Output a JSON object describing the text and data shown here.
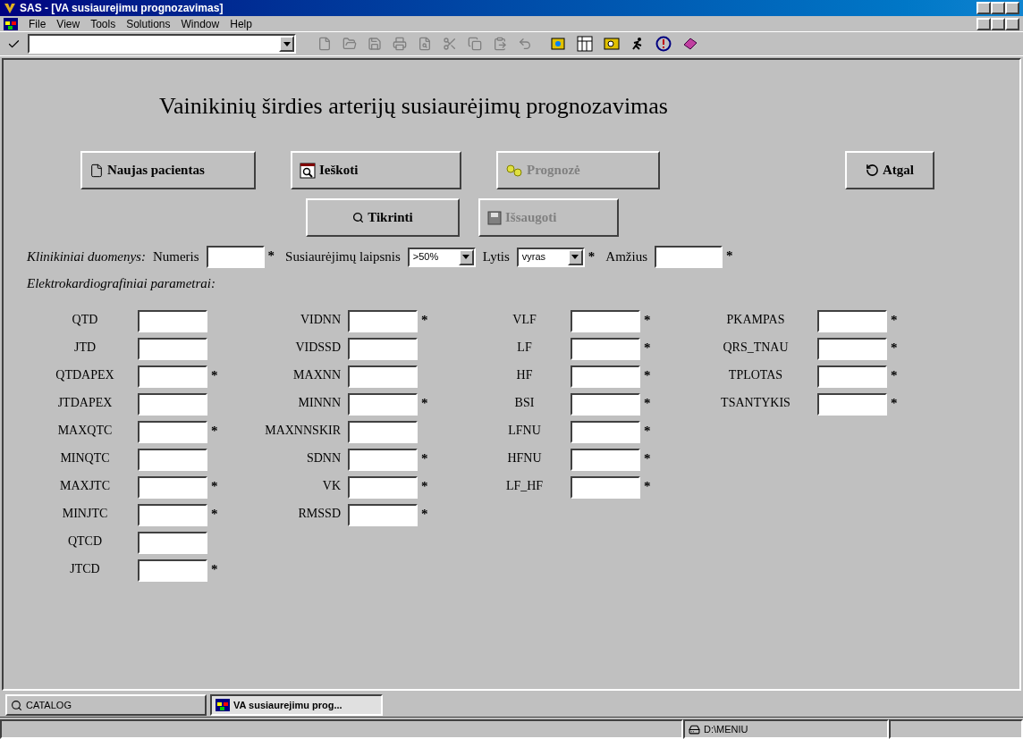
{
  "window": {
    "title": "SAS - [VA susiaurejimu prognozavimas]"
  },
  "menu": [
    "File",
    "View",
    "Tools",
    "Solutions",
    "Window",
    "Help"
  ],
  "form": {
    "heading": "Vainikinių širdies arterijų susiaurėjimų prognozavimas",
    "buttons_row1": [
      {
        "label": "Naujas pacientas",
        "kind": "new",
        "disabled": false
      },
      {
        "label": "Ieškoti",
        "kind": "find",
        "disabled": false
      },
      {
        "label": "Prognozė",
        "kind": "predict",
        "disabled": true
      },
      {
        "label": "Atgal",
        "kind": "back",
        "disabled": false
      }
    ],
    "buttons_row2": [
      {
        "label": "Tikrinti",
        "kind": "check",
        "disabled": false
      },
      {
        "label": "Išsaugoti",
        "kind": "save",
        "disabled": true
      }
    ],
    "clinical": {
      "title": "Klinikiniai duomenys:",
      "fields": [
        {
          "label": "Numeris",
          "kind": "text",
          "note": "*"
        },
        {
          "label": "Susiaurėjimų laipsnis",
          "kind": "select",
          "value": ">50%"
        },
        {
          "label": "Lytis",
          "kind": "select",
          "value": "vyras",
          "note": "*"
        },
        {
          "label": "Amžius",
          "kind": "text",
          "note": "*"
        }
      ]
    },
    "ecg_title": "Elektrokardiografiniai parametrai:",
    "columns": [
      [
        {
          "label": "QTD"
        },
        {
          "label": "JTD"
        },
        {
          "label": "QTDAPEX",
          "note": "*"
        },
        {
          "label": "JTDAPEX"
        },
        {
          "label": "MAXQTC",
          "note": "*"
        },
        {
          "label": "MINQTC"
        },
        {
          "label": "MAXJTC",
          "note": "*"
        },
        {
          "label": "MINJTC",
          "note": "*"
        },
        {
          "label": "QTCD"
        },
        {
          "label": "JTCD",
          "note": "*"
        }
      ],
      [
        {
          "label": "VIDNN",
          "note": "*"
        },
        {
          "label": "VIDSSD"
        },
        {
          "label": "MAXNN"
        },
        {
          "label": "MINNN",
          "note": "*"
        },
        {
          "label": "MAXNNSKIR"
        },
        {
          "label": "SDNN",
          "note": "*"
        },
        {
          "label": "VK",
          "note": "*"
        },
        {
          "label": "RMSSD",
          "note": "*"
        }
      ],
      [
        {
          "label": "VLF",
          "note": "*"
        },
        {
          "label": "LF",
          "note": "*"
        },
        {
          "label": "HF",
          "note": "*"
        },
        {
          "label": "BSI",
          "note": "*"
        },
        {
          "label": "LFNU",
          "note": "*"
        },
        {
          "label": "HFNU",
          "note": "*"
        },
        {
          "label": "LF_HF",
          "note": "*"
        }
      ],
      [
        {
          "label": "PKAMPAS",
          "note": "*"
        },
        {
          "label": "QRS_TNAU",
          "note": "*"
        },
        {
          "label": "TPLOTAS",
          "note": "*"
        },
        {
          "label": "TSANTYKIS",
          "note": "*"
        }
      ]
    ]
  },
  "taskbar": [
    {
      "label": "CATALOG",
      "selected": false
    },
    {
      "label": "VA susiaurejimu prog...",
      "selected": true
    }
  ],
  "status_bar": {
    "path": "D:\\MENIU"
  }
}
